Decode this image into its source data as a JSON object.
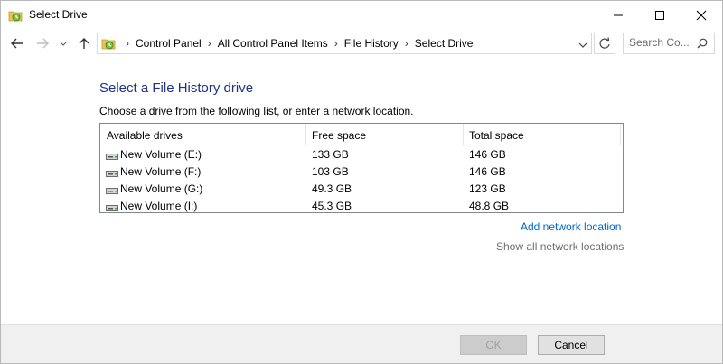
{
  "window": {
    "title": "Select Drive"
  },
  "nav": {
    "breadcrumbs": [
      "Control Panel",
      "All Control Panel Items",
      "File History",
      "Select Drive"
    ],
    "search_placeholder": "Search Co..."
  },
  "main": {
    "heading": "Select a File History drive",
    "instruction": "Choose a drive from the following list, or enter a network location.",
    "columns": [
      "Available drives",
      "Free space",
      "Total space"
    ],
    "drives": [
      {
        "name": "New Volume (E:)",
        "free": "133 GB",
        "total": "146 GB"
      },
      {
        "name": "New Volume (F:)",
        "free": "103 GB",
        "total": "146 GB"
      },
      {
        "name": "New Volume (G:)",
        "free": "49.3 GB",
        "total": "123 GB"
      },
      {
        "name": "New Volume (I:)",
        "free": "45.3 GB",
        "total": "48.8 GB"
      }
    ],
    "add_network_location": "Add network location",
    "show_all_network_locations": "Show all network locations"
  },
  "footer": {
    "ok_label": "OK",
    "cancel_label": "Cancel"
  },
  "colors": {
    "heading": "#1e3287",
    "link": "#0066cc",
    "disabled_link": "#6d6d6d"
  }
}
